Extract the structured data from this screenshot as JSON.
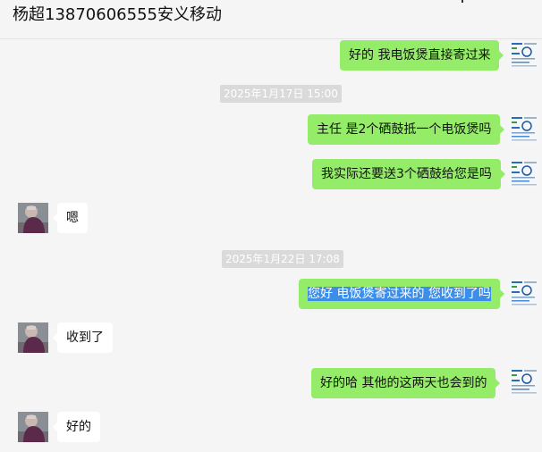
{
  "header": {
    "title": "杨超13870606555安义移动"
  },
  "messages": [
    {
      "type": "out",
      "text": "好的 我电饭煲直接寄过来"
    },
    {
      "type": "time",
      "text": "2025年1月17日 15:00"
    },
    {
      "type": "out",
      "text": "主任 是2个硒鼓抵一个电饭煲吗"
    },
    {
      "type": "out",
      "text": "我实际还要送3个硒鼓给您是吗"
    },
    {
      "type": "in",
      "text": "嗯"
    },
    {
      "type": "time",
      "text": "2025年1月22日 17:08"
    },
    {
      "type": "out",
      "text": "您好 电饭煲寄过来的 您收到了吗",
      "selected": true
    },
    {
      "type": "in",
      "text": "收到了"
    },
    {
      "type": "out",
      "text": "好的哈  其他的这两天也会到的"
    },
    {
      "type": "in",
      "text": "好的"
    }
  ],
  "avatars": {
    "self": "document-thumbnail-avatar",
    "contact": "person-photo-avatar"
  },
  "colors": {
    "outgoing_bubble": "#95ec69",
    "incoming_bubble": "#ffffff",
    "background": "#f5f5f5",
    "timestamp_bg": "#dadada",
    "selection": "#3d8ee8"
  }
}
